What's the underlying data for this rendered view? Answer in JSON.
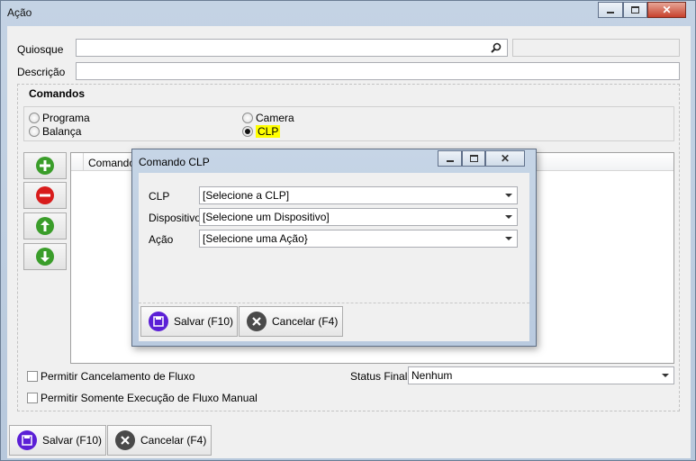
{
  "window": {
    "title": "Ação",
    "controls": {
      "minimize_icon": "minimize-icon",
      "maximize_icon": "maximize-icon",
      "close_icon": "close-icon"
    }
  },
  "form": {
    "quiosque_label": "Quiosque",
    "descricao_label": "Descrição",
    "comandos_title": "Comandos",
    "radios": {
      "programa": "Programa",
      "balanca": "Balança",
      "camera": "Camera",
      "clp": "CLP",
      "selected": "CLP"
    },
    "grid": {
      "column_comando": "Comando"
    },
    "permitir_cancelamento": "Permitir Cancelamento de Fluxo",
    "permitir_somente": "Permitir Somente Execução de Fluxo Manual",
    "status_final_label": "Status Final",
    "status_final_value": "Nenhum",
    "save_label": "Salvar (F10)",
    "cancel_label": "Cancelar (F4)"
  },
  "dialog": {
    "title": "Comando CLP",
    "clp_label": "CLP",
    "clp_value": "[Selecione a CLP]",
    "dispositivo_label": "Dispositivo",
    "dispositivo_value": "[Selecione um Dispositivo]",
    "acao_label": "Ação",
    "acao_value": "[Selecione uma Ação}",
    "save_label": "Salvar (F10)",
    "cancel_label": "Cancelar (F4)"
  },
  "colors": {
    "highlight": "#ffff00",
    "add": "#3a9d2a",
    "remove": "#d81c1c",
    "save_icon": "#5b1fd6"
  }
}
